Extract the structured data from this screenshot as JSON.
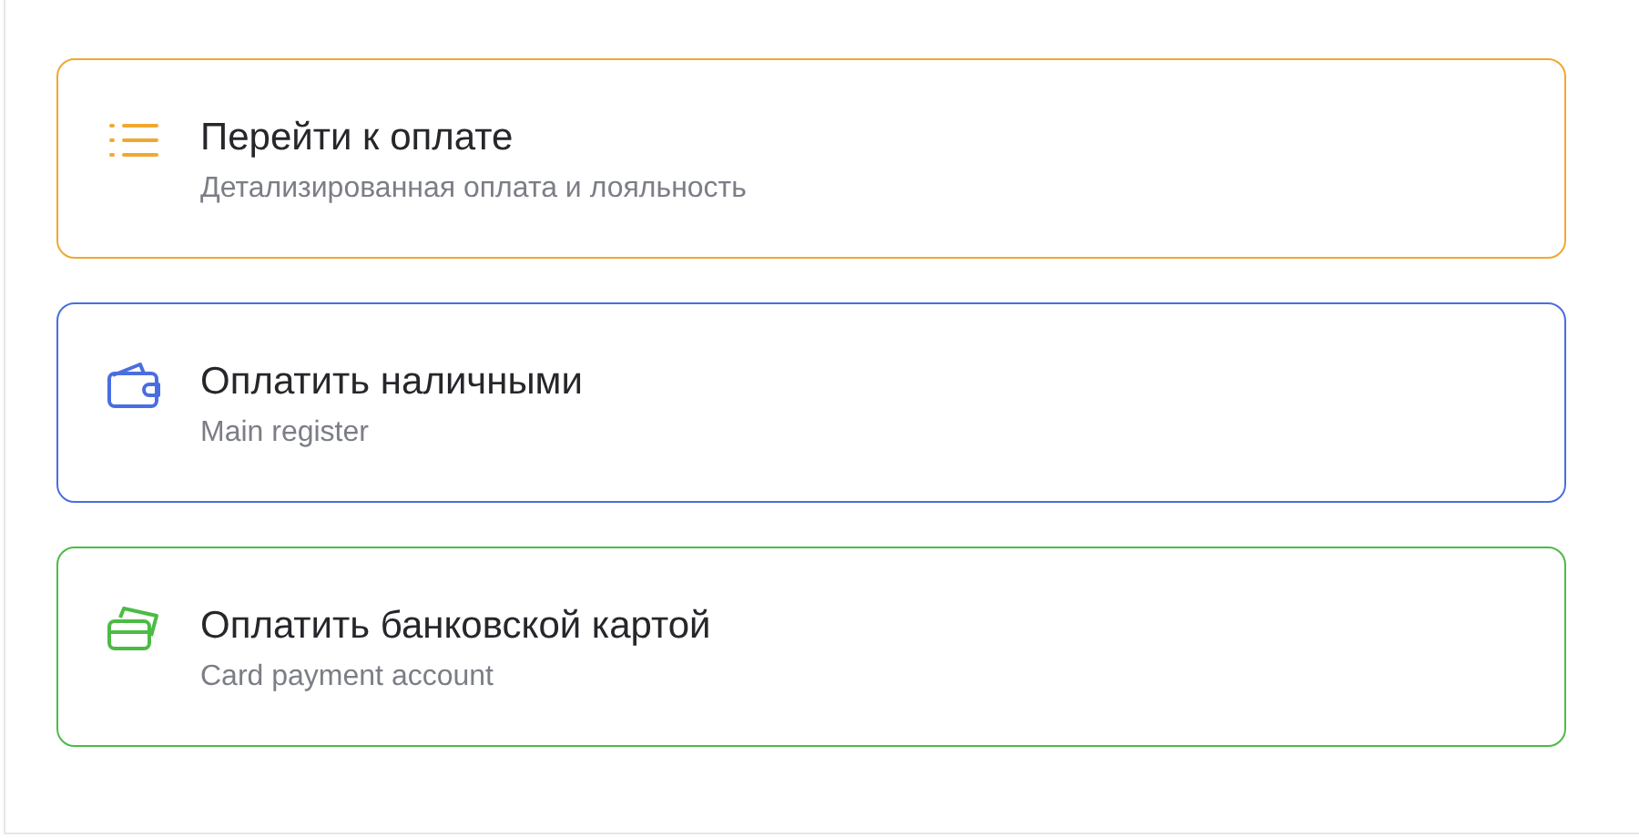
{
  "options": [
    {
      "kind": "list",
      "title": "Перейти к оплате",
      "subtitle": "Детализированная оплата и лояльность",
      "color": "#f0a830"
    },
    {
      "kind": "wallet",
      "title": "Оплатить наличными",
      "subtitle": "Main register",
      "color": "#4a6ee0"
    },
    {
      "kind": "card",
      "title": "Оплатить банковской картой",
      "subtitle": "Card payment account",
      "color": "#4cbb45"
    }
  ]
}
